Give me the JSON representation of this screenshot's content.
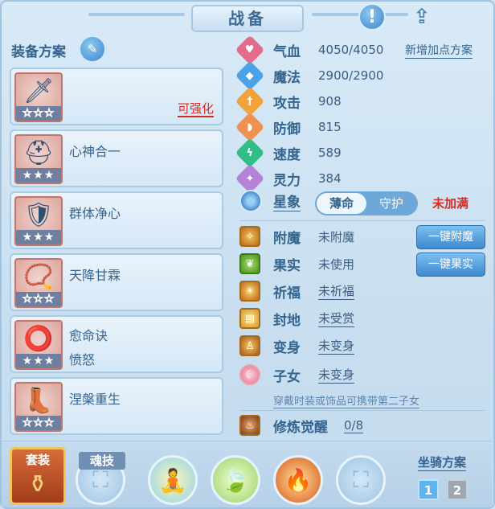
{
  "header": {
    "title": "战备"
  },
  "left": {
    "section_title": "装备方案",
    "cards": [
      {
        "name": "",
        "enhance": "可强化",
        "stars": "☆☆☆",
        "icon": "sword-icon",
        "glyph": "🗡"
      },
      {
        "name": "心神合一",
        "stars": "★★★",
        "icon": "helmet-icon",
        "glyph": "⛑"
      },
      {
        "name": "群体净心",
        "stars": "★★★",
        "icon": "armor-icon",
        "glyph": "🛡"
      },
      {
        "name": "天降甘霖",
        "stars": "☆☆☆",
        "icon": "necklace-icon",
        "glyph": "📿"
      },
      {
        "name": "愈命诀",
        "name2": "愤怒",
        "stars": "★★★",
        "icon": "belt-icon",
        "glyph": "⭕"
      },
      {
        "name": "涅槃重生",
        "stars": "☆☆☆",
        "icon": "boots-icon",
        "glyph": "👢"
      }
    ]
  },
  "attrs": [
    {
      "label": "气血",
      "value": "4050/4050",
      "color": "#e46b8b",
      "glyph": "♥"
    },
    {
      "label": "魔法",
      "value": "2900/2900",
      "color": "#4aa3e8",
      "glyph": "◆"
    },
    {
      "label": "攻击",
      "value": "908",
      "color": "#f2a23a",
      "glyph": "†"
    },
    {
      "label": "防御",
      "value": "815",
      "color": "#ef9251",
      "glyph": "◗"
    },
    {
      "label": "速度",
      "value": "589",
      "color": "#2fbf86",
      "glyph": "ϟ"
    },
    {
      "label": "灵力",
      "value": "384",
      "color": "#b483d8",
      "glyph": "✦"
    }
  ],
  "addpoint": "新增加点方案",
  "star": {
    "label": "星象",
    "opt1": "薄命",
    "opt2": "守护",
    "status": "未加满"
  },
  "misc": [
    {
      "label": "附魔",
      "value": "未附魔",
      "underline": false
    },
    {
      "label": "果实",
      "value": "未使用",
      "underline": false
    },
    {
      "label": "祈福",
      "value": "未祈福",
      "underline": true
    },
    {
      "label": "封地",
      "value": "未受赏",
      "underline": true
    },
    {
      "label": "变身",
      "value": "未变身",
      "underline": true
    },
    {
      "label": "子女",
      "value": "未变身",
      "underline": true
    }
  ],
  "actions": {
    "enchant": "一键附魔",
    "fruit": "一键果实"
  },
  "hint": "穿戴时装或饰品可携带第二子女",
  "cultivate": {
    "label": "修炼觉醒",
    "value": "0/8"
  },
  "bottom": {
    "suit": "套装",
    "soul": "魂技",
    "mount_title": "坐骑方案",
    "mount1": "1",
    "mount2": "2"
  }
}
